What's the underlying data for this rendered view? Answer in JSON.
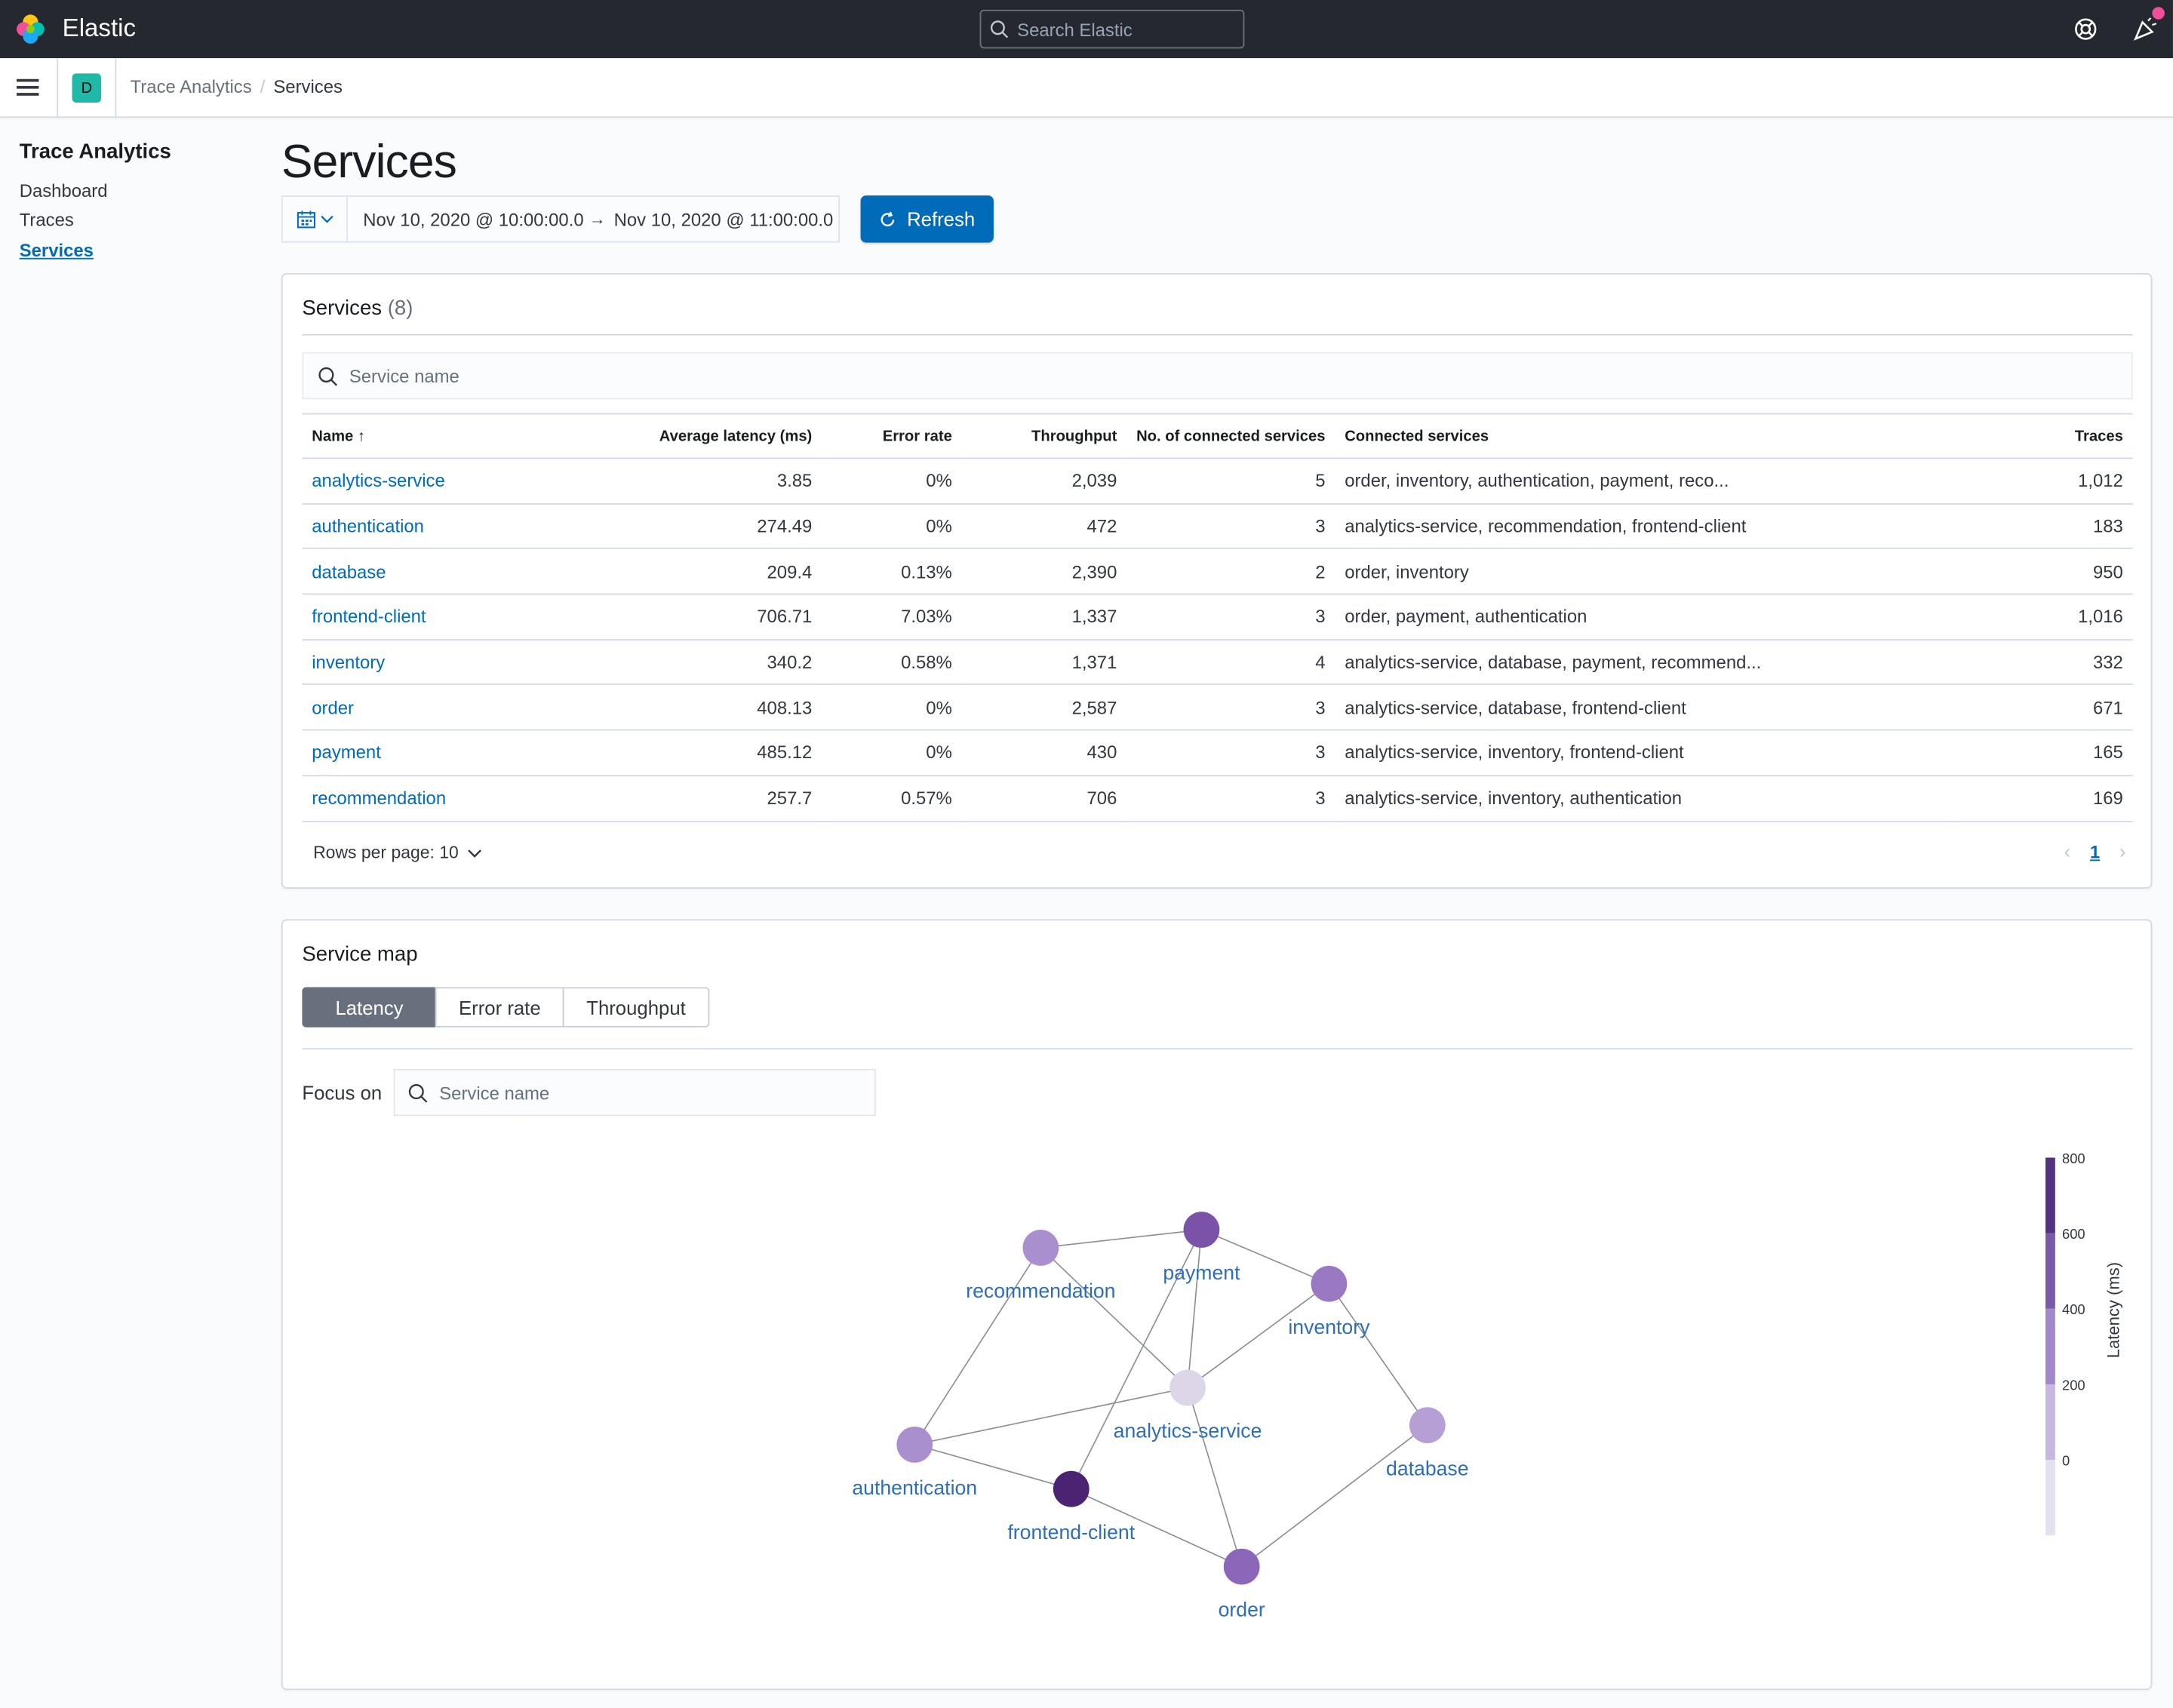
{
  "header": {
    "brand": "Elastic",
    "search_placeholder": "Search Elastic",
    "space_initial": "D"
  },
  "breadcrumbs": [
    "Trace Analytics",
    "Services"
  ],
  "sidebar": {
    "title": "Trace Analytics",
    "items": [
      {
        "label": "Dashboard",
        "active": false
      },
      {
        "label": "Traces",
        "active": false
      },
      {
        "label": "Services",
        "active": true
      }
    ]
  },
  "page": {
    "title": "Services",
    "date_start": "Nov 10, 2020 @ 10:00:00.0",
    "date_arrow": "→",
    "date_end": "Nov 10, 2020 @ 11:00:00.0",
    "refresh_label": "Refresh"
  },
  "services_panel": {
    "title": "Services",
    "count": "(8)",
    "search_placeholder": "Service name",
    "columns": [
      "Name",
      "Average latency (ms)",
      "Error rate",
      "Throughput",
      "No. of connected services",
      "Connected services",
      "Traces"
    ],
    "sort_indicator": "↑",
    "rows": [
      [
        "analytics-service",
        "3.85",
        "0%",
        "2,039",
        "5",
        "order, inventory, authentication, payment, reco...",
        "1,012"
      ],
      [
        "authentication",
        "274.49",
        "0%",
        "472",
        "3",
        "analytics-service, recommendation, frontend-client",
        "183"
      ],
      [
        "database",
        "209.4",
        "0.13%",
        "2,390",
        "2",
        "order, inventory",
        "950"
      ],
      [
        "frontend-client",
        "706.71",
        "7.03%",
        "1,337",
        "3",
        "order, payment, authentication",
        "1,016"
      ],
      [
        "inventory",
        "340.2",
        "0.58%",
        "1,371",
        "4",
        "analytics-service, database, payment, recommend...",
        "332"
      ],
      [
        "order",
        "408.13",
        "0%",
        "2,587",
        "3",
        "analytics-service, database, frontend-client",
        "671"
      ],
      [
        "payment",
        "485.12",
        "0%",
        "430",
        "3",
        "analytics-service, inventory, frontend-client",
        "165"
      ],
      [
        "recommendation",
        "257.7",
        "0.57%",
        "706",
        "3",
        "analytics-service, inventory, authentication",
        "169"
      ]
    ],
    "rows_per_page": "Rows per page: 10",
    "current_page": "1"
  },
  "service_map": {
    "title": "Service map",
    "tabs": [
      {
        "label": "Latency",
        "selected": true
      },
      {
        "label": "Error rate",
        "selected": false
      },
      {
        "label": "Throughput",
        "selected": false
      }
    ],
    "focus_label": "Focus on",
    "focus_placeholder": "Service name",
    "legend_title": "Latency (ms)",
    "legend_ticks": [
      "800",
      "600",
      "400",
      "200",
      "0"
    ],
    "legend_colors": [
      "#54327e",
      "#7a59a8",
      "#a189c8",
      "#c8b8df",
      "#e4e0ee"
    ],
    "nodes": [
      {
        "name": "recommendation",
        "latency": 257.7,
        "color": "#a98fcd"
      },
      {
        "name": "payment",
        "latency": 485.12,
        "color": "#7a52a8"
      },
      {
        "name": "inventory",
        "latency": 340.2,
        "color": "#9a78c2"
      },
      {
        "name": "analytics-service",
        "latency": 3.85,
        "color": "#dcd6e8"
      },
      {
        "name": "authentication",
        "latency": 274.49,
        "color": "#a98fcd"
      },
      {
        "name": "database",
        "latency": 209.4,
        "color": "#b59fd5"
      },
      {
        "name": "frontend-client",
        "latency": 706.71,
        "color": "#4a2473"
      },
      {
        "name": "order",
        "latency": 408.13,
        "color": "#8c66b8"
      }
    ],
    "edges": [
      [
        "recommendation",
        "payment"
      ],
      [
        "recommendation",
        "analytics-service"
      ],
      [
        "recommendation",
        "authentication"
      ],
      [
        "payment",
        "inventory"
      ],
      [
        "payment",
        "analytics-service"
      ],
      [
        "payment",
        "frontend-client"
      ],
      [
        "inventory",
        "analytics-service"
      ],
      [
        "inventory",
        "database"
      ],
      [
        "analytics-service",
        "authentication"
      ],
      [
        "analytics-service",
        "order"
      ],
      [
        "authentication",
        "frontend-client"
      ],
      [
        "frontend-client",
        "order"
      ],
      [
        "order",
        "database"
      ]
    ]
  }
}
